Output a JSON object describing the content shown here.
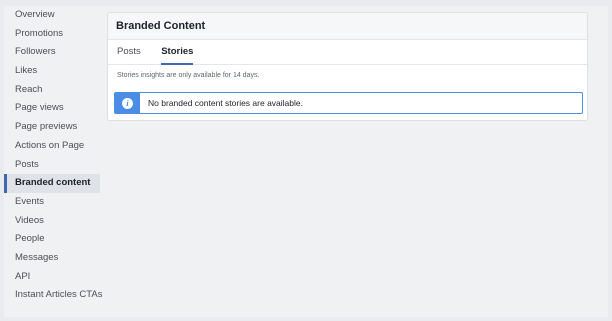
{
  "sidebar": {
    "items": [
      {
        "label": "Overview"
      },
      {
        "label": "Promotions"
      },
      {
        "label": "Followers"
      },
      {
        "label": "Likes"
      },
      {
        "label": "Reach"
      },
      {
        "label": "Page views"
      },
      {
        "label": "Page previews"
      },
      {
        "label": "Actions on Page"
      },
      {
        "label": "Posts"
      },
      {
        "label": "Branded content",
        "active": true
      },
      {
        "label": "Events"
      },
      {
        "label": "Videos"
      },
      {
        "label": "People"
      },
      {
        "label": "Messages"
      },
      {
        "label": "API"
      },
      {
        "label": "Instant Articles CTAs"
      }
    ]
  },
  "panel": {
    "title": "Branded Content",
    "tabs": [
      {
        "label": "Posts"
      },
      {
        "label": "Stories",
        "active": true
      }
    ],
    "note": "Stories insights are only available for 14 days.",
    "info": {
      "icon": "info-icon",
      "icon_glyph": "i",
      "message": "No branded content stories are available."
    }
  },
  "colors": {
    "accent": "#4267b2",
    "info_blue": "#4b8de6",
    "background": "#e9ebee"
  }
}
